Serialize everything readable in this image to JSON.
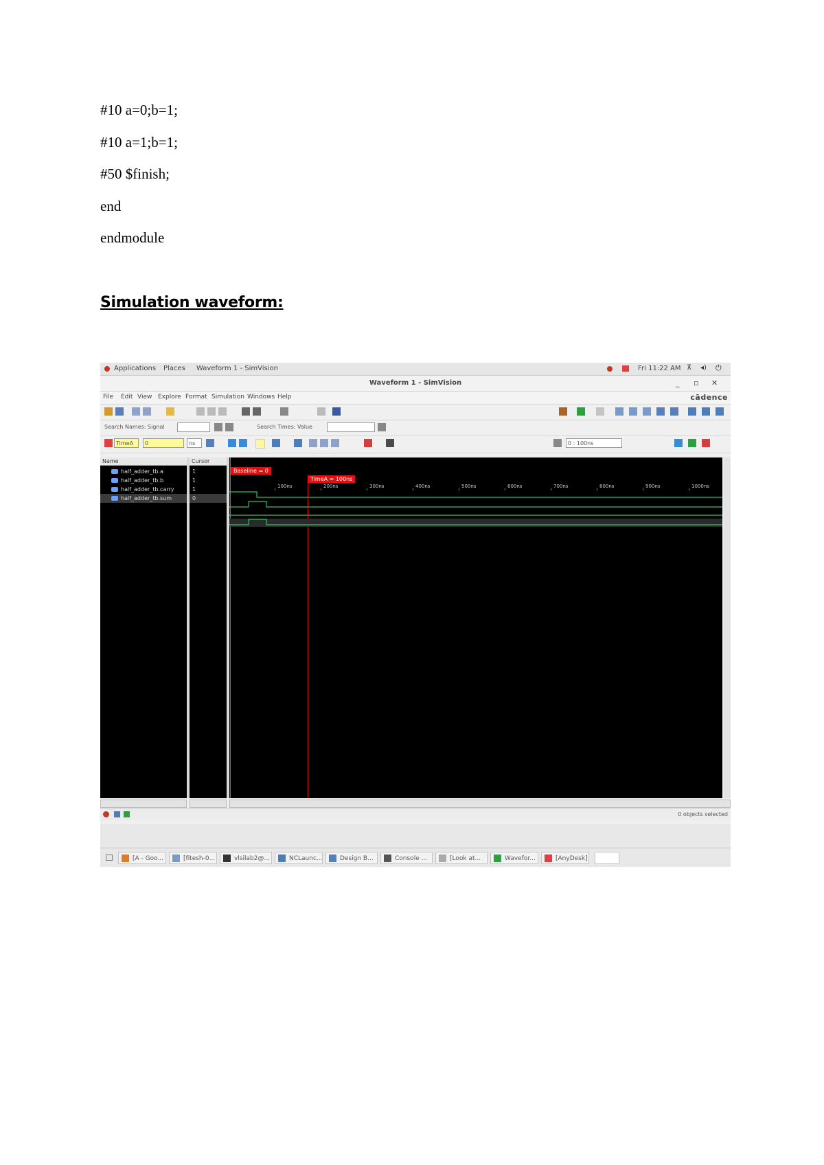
{
  "code_lines": [
    "#10 a=0;b=1;",
    "#10 a=1;b=1;",
    "#50 $finish;",
    "end",
    "endmodule"
  ],
  "heading": "Simulation waveform:",
  "screenshot": {
    "topbar": {
      "applications": "Applications",
      "places": "Places",
      "window": "Waveform 1 - SimVision",
      "clock": "Fri 11:22 AM"
    },
    "window_title": "Waveform 1 - SimVision",
    "brand": "cādence",
    "menu": [
      "File",
      "Edit",
      "View",
      "Explore",
      "Format",
      "Simulation",
      "Windows",
      "Help"
    ],
    "search_names_label": "Search Names: Signal",
    "search_times_label": "Search Times: Value",
    "time_label": "TimeA",
    "time_value": "0",
    "time_unit": "ns",
    "zoom_value": "0 : 100ns",
    "cursor_label": "Baseline = 0",
    "cursor_time": "TimeA = 100ns",
    "panel_labels": {
      "name": "Name",
      "cursor": "Cursor"
    },
    "signals": [
      {
        "name": "half_adder_tb.a",
        "value": "1",
        "selected": false
      },
      {
        "name": "half_adder_tb.b",
        "value": "1",
        "selected": false
      },
      {
        "name": "half_adder_tb.carry",
        "value": "1",
        "selected": false
      },
      {
        "name": "half_adder_tb.sum",
        "value": "0",
        "selected": true
      }
    ],
    "ticks": [
      "0",
      "100ns",
      "200ns",
      "300ns",
      "400ns",
      "500ns",
      "600ns",
      "700ns",
      "800ns",
      "900ns",
      "1000ns"
    ],
    "status_right": "0 objects selected",
    "taskbar": [
      "[A - Goo...",
      "[fitesh-0...",
      "vlsilab2@...",
      "NCLaunc...",
      "Design B...",
      "Console ...",
      "[Look at...",
      "Wavefor...",
      "[AnyDesk]"
    ],
    "colors": {
      "wave": "#22c55e",
      "cursor": "#d01010",
      "background": "#000000"
    }
  }
}
